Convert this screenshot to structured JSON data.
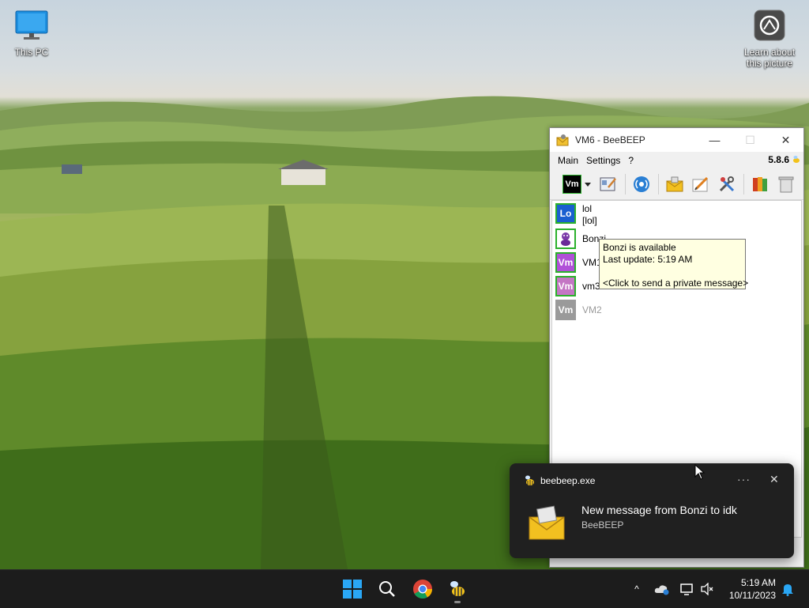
{
  "desktop": {
    "icons": [
      {
        "label": "This PC"
      },
      {
        "label_line1": "Learn about",
        "label_line2": "this picture"
      }
    ]
  },
  "window": {
    "title": "VM6 - BeeBEEP",
    "controls": {
      "minimize": "—",
      "maximize": "☐",
      "close": "✕"
    },
    "menu": [
      "Main",
      "Settings",
      "?"
    ],
    "version": "5.8.6",
    "status_badge": "Vm",
    "users": [
      {
        "avatar": "Lo",
        "avatar_color": "#1a5fd0",
        "name": "lol",
        "subname": "[lol]",
        "online": true
      },
      {
        "avatar": "",
        "avatar_color": "#ffffff",
        "name": "Bonzi",
        "subname": "",
        "online": true
      },
      {
        "avatar": "Vm",
        "avatar_color": "#b050d8",
        "name": "VM1",
        "subname": "",
        "online": true
      },
      {
        "avatar": "Vm",
        "avatar_color": "#c476c4",
        "name": "vm3",
        "subname": "",
        "online": true
      },
      {
        "avatar": "Vm",
        "avatar_color": "#9a9a9a",
        "name": "VM2",
        "subname": "",
        "online": false
      }
    ]
  },
  "tooltip": {
    "line1": "Bonzi is available",
    "line2": "Last update: 5:19 AM",
    "line3": "<Click to send a private message>"
  },
  "toast": {
    "app": "beebeep.exe",
    "more": "···",
    "close": "✕",
    "title": "New message from Bonzi to idk",
    "subtitle": "BeeBEEP"
  },
  "taskbar": {
    "time": "5:19 AM",
    "date": "10/11/2023",
    "tray_chevron": "^"
  }
}
